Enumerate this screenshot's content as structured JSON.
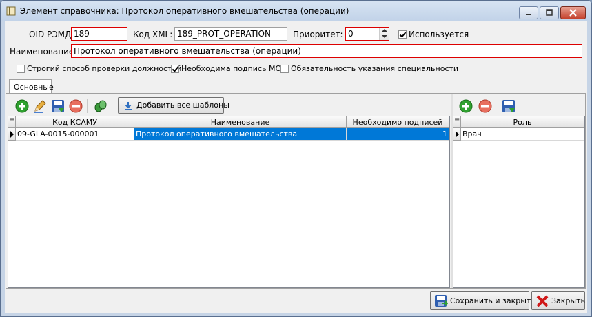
{
  "window": {
    "title": "Элемент справочника: Протокол оперативного вмешательства (операции)"
  },
  "form": {
    "oid_label": "OID РЭМД:",
    "oid_value": "189",
    "xml_label": "Код XML:",
    "xml_value": "189_PROT_OPERATION",
    "priority_label": "Приоритет:",
    "priority_value": "0",
    "used_label": "Используется",
    "used_checked": true,
    "name_label": "Наименование:",
    "name_value": "Протокол оперативного вмешательства (операции)",
    "options": [
      {
        "label": "Строгий способ проверки должностей",
        "checked": false
      },
      {
        "label": "Необходима подпись МО",
        "checked": true
      },
      {
        "label": "Обязательность указания специальности",
        "checked": false
      }
    ]
  },
  "tabs": [
    {
      "label": "Основные",
      "active": true
    }
  ],
  "templates": {
    "toolbar": {
      "add_icon": "add-icon",
      "edit_icon": "edit-icon",
      "save_icon": "save-icon",
      "delete_icon": "delete-icon",
      "link_icon": "link-icon",
      "add_all_label": "Добавить все шаблоны"
    },
    "columns": [
      "Код КСАМУ",
      "Наименование",
      "Необходимо подписей"
    ],
    "rows": [
      {
        "code": "09-GLA-0015-000001",
        "name": "Протокол оперативного вмешательства",
        "signatures": "1"
      }
    ]
  },
  "roles": {
    "columns": [
      "Роль"
    ],
    "rows": [
      {
        "role": "Врач"
      }
    ]
  },
  "footer": {
    "save_close_label": "Сохранить и закрыть",
    "close_label": "Закрыть"
  },
  "colors": {
    "accent": "#0078d7",
    "required_border": "#dd0000"
  }
}
